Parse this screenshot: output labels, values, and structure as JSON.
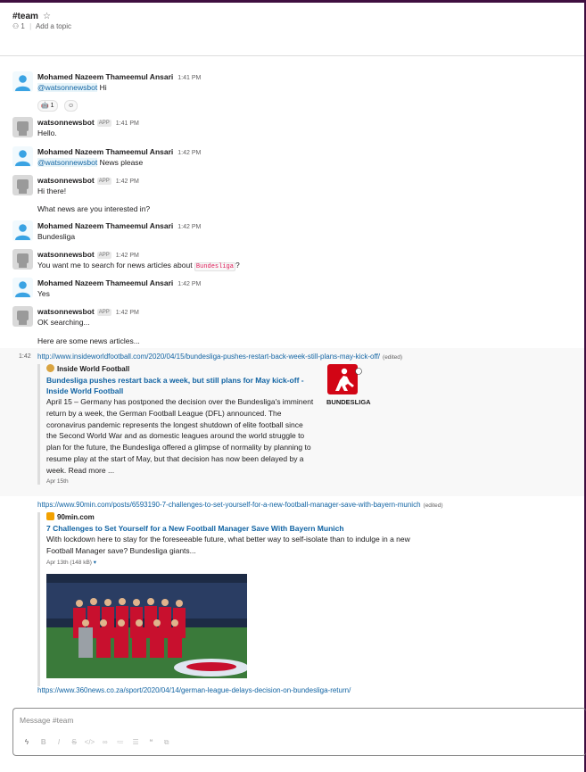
{
  "channel": {
    "name": "#team",
    "members": "1",
    "topic_link": "Add a topic"
  },
  "messages": [
    {
      "user": "Mohamed Nazeem Thameemul Ansari",
      "app": false,
      "time": "1:41 PM",
      "mention": "@watsonnewsbot",
      "text": "Hi",
      "reaction": {
        "emoji": "robot",
        "count": "1"
      }
    },
    {
      "user": "watsonnewsbot",
      "app": true,
      "app_label": "APP",
      "time": "1:41 PM",
      "text": "Hello."
    },
    {
      "user": "Mohamed Nazeem Thameemul Ansari",
      "app": false,
      "time": "1:42 PM",
      "mention": "@watsonnewsbot",
      "text": "News please"
    },
    {
      "user": "watsonnewsbot",
      "app": true,
      "app_label": "APP",
      "time": "1:42 PM",
      "text": "Hi there!",
      "followup": "What news are you interested in?"
    },
    {
      "user": "Mohamed Nazeem Thameemul Ansari",
      "app": false,
      "time": "1:42 PM",
      "text": "Bundesliga"
    },
    {
      "user": "watsonnewsbot",
      "app": true,
      "app_label": "APP",
      "time": "1:42 PM",
      "text_before": "You want me to search for news articles about ",
      "code": "Bundesliga",
      "text_after": "?"
    },
    {
      "user": "Mohamed Nazeem Thameemul Ansari",
      "app": false,
      "time": "1:42 PM",
      "text": "Yes"
    },
    {
      "user": "watsonnewsbot",
      "app": true,
      "app_label": "APP",
      "time": "1:42 PM",
      "text": "OK searching...",
      "followup": "Here are some news articles..."
    }
  ],
  "links": [
    {
      "gutter_time": "1:42",
      "url": "http://www.insideworldfootball.com/2020/04/15/bundesliga-pushes-restart-back-week-still-plans-may-kick-off/",
      "edited": "(edited)",
      "site": "Inside World Football",
      "title": "Bundesliga pushes restart back a week, but still plans for May kick-off - Inside World Football",
      "description": "April 15 – Germany has postponed the decision over the Bundesliga's imminent return by a week, the German Football League (DFL) announced. The coronavirus pandemic represents the longest shutdown of elite football since the Second World War and as domestic leagues around the world struggle to plan for the future, the Bundesliga offered a glimpse of normality by planning to resume play at the start of May, but that decision has now been delayed by a week. Read more ...",
      "date": "Apr 15th",
      "thumb_text": "BUNDESLIGA"
    },
    {
      "url": "https://www.90min.com/posts/6593190-7-challenges-to-set-yourself-for-a-new-football-manager-save-with-bayern-munich",
      "edited": "(edited)",
      "site": "90min.com",
      "title": "7 Challenges to Set Yourself for a New Football Manager Save With Bayern Munich",
      "description": "With lockdown here to stay for the foreseeable future, what better way to self-isolate than to indulge in a new Football Manager save?  Bundesliga giants...",
      "date": "Apr 13th (148 kB)"
    },
    {
      "url": "https://www.360news.co.za/sport/2020/04/14/german-league-delays-decision-on-bundesliga-return/"
    }
  ],
  "composer": {
    "placeholder": "Message #team",
    "tools": [
      "bolt-icon",
      "bold-icon",
      "italic-icon",
      "strike-icon",
      "code-icon",
      "link-icon",
      "ordered-list-icon",
      "bullet-list-icon",
      "quote-icon",
      "code-block-icon"
    ]
  },
  "colors": {
    "link": "#1264a3",
    "sidebar": "#3f0e40",
    "mention_bg": "#e8f5fa",
    "code": "#e01e5a",
    "bundesliga_red": "#d20515"
  }
}
